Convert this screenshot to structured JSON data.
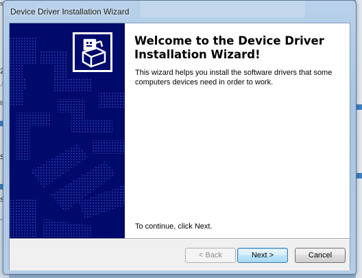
{
  "window": {
    "title": "Device Driver Installation Wizard"
  },
  "welcome": {
    "heading": "Welcome to the Device Driver Installation Wizard!",
    "description": "This wizard helps you install the software drivers that some computers devices need in order to work.",
    "continue_hint": "To continue, click Next."
  },
  "buttons": {
    "back": "< Back",
    "next": "Next >",
    "cancel": "Cancel",
    "back_enabled": false,
    "default_button": "next"
  },
  "background_fragments": [
    "2.",
    ".6",
    "ls",
    "st",
    "s",
    "s l",
    "-+"
  ],
  "colors": {
    "banner": "#000a6b",
    "banner_pattern": "#1f2fa5",
    "default_button_border": "#3c7fb1"
  },
  "icons": {
    "wizard_logo": "device-installer-icon"
  }
}
